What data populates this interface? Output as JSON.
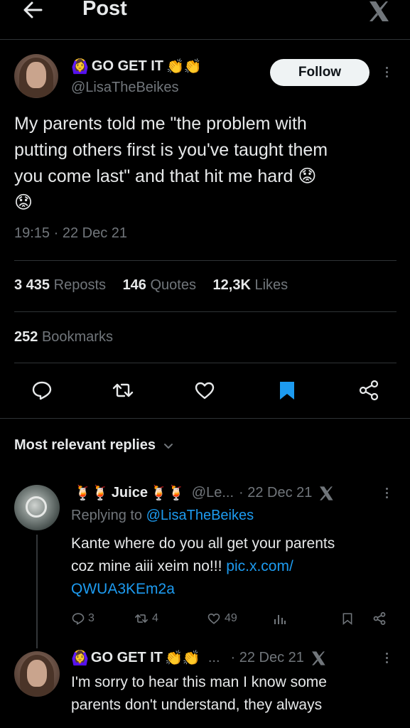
{
  "header": {
    "title": "Post"
  },
  "post": {
    "author": {
      "emoji_prefix": "🙆‍♀️",
      "name": "GO GET IT",
      "emoji_suffix": "👏👏",
      "handle": "@LisaTheBeikes"
    },
    "follow_label": "Follow",
    "text_line1": "My parents told me \"the problem with",
    "text_line2": "putting others first is you've taught them",
    "text_line3": "you come last\" and that hit me hard",
    "text_emoji1": "😟",
    "text_emoji2": "😟",
    "timestamp": "19:15 · 22 Dec 21",
    "stats": {
      "reposts_count": "3 435",
      "reposts_label": "Reposts",
      "quotes_count": "146",
      "quotes_label": "Quotes",
      "likes_count": "12,3K",
      "likes_label": "Likes",
      "bookmarks_count": "252",
      "bookmarks_label": "Bookmarks"
    }
  },
  "replies_section": {
    "title": "Most relevant replies"
  },
  "replies": [
    {
      "emoji_prefix": "🍹🍹",
      "name": "Juice",
      "emoji_suffix": "🍹🍹",
      "handle": "@Le...",
      "date": "· 22 Dec 21",
      "replying_prefix": "Replying to",
      "replying_handle": "@LisaTheBeikes",
      "text_line1": "Kante where do you all get your parents",
      "text_line2_plain": "coz mine aiii xeim no!!!",
      "text_link1": "pic.x.com/",
      "text_link2": "QWUA3KEm2a",
      "reply_count": "3",
      "repost_count": "4",
      "like_count": "49"
    },
    {
      "emoji_prefix": "🙆‍♀️",
      "name": "GO GET IT",
      "emoji_suffix": "👏👏",
      "ellipsis": "...",
      "date": "· 22 Dec 21",
      "text_line1": "I'm sorry to hear this man I know some",
      "text_line2": "parents don't understand, they always"
    }
  ],
  "colors": {
    "background": "#000000",
    "text": "#e7e9ea",
    "muted": "#71767b",
    "link": "#1d9bf0",
    "bookmark_active": "#1d9bf0",
    "divider": "#2f3336"
  }
}
